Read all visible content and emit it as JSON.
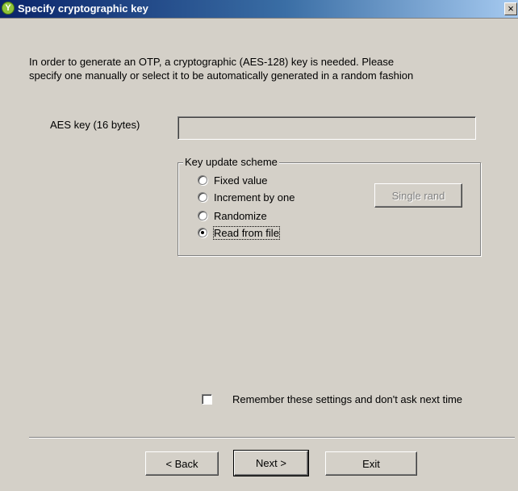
{
  "window": {
    "title": "Specify cryptographic key",
    "icon": "yubico-logo-icon",
    "close_glyph": "×"
  },
  "intro": {
    "line1": "In order to generate an OTP, a cryptographic (AES-128) key is needed. Please",
    "line2": "specify one manually or select it to be automatically generated in a random fashion"
  },
  "aes_key": {
    "label": "AES key (16 bytes)",
    "value": "",
    "placeholder": ""
  },
  "key_update": {
    "legend": "Key update scheme",
    "options": [
      {
        "label": "Fixed value",
        "checked": false
      },
      {
        "label": "Increment by one",
        "checked": false
      },
      {
        "label": "Randomize",
        "checked": false
      },
      {
        "label": "Read from file",
        "checked": true
      }
    ],
    "single_rand_label": "Single rand"
  },
  "remember": {
    "label": "Remember these settings and don't ask next time",
    "checked": false
  },
  "footer": {
    "back_label": "< Back",
    "next_label": "Next >",
    "exit_label": "Exit"
  }
}
